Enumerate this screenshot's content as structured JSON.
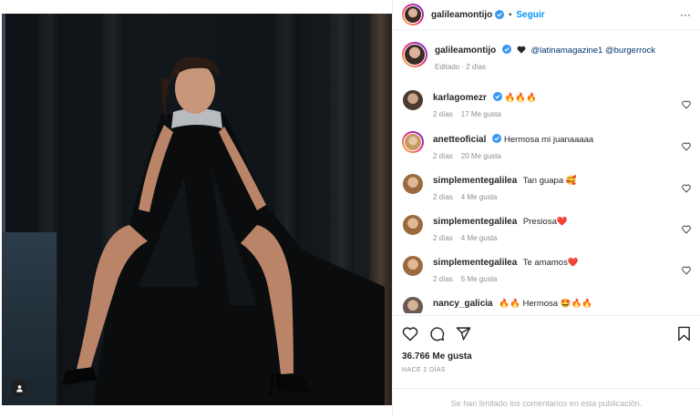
{
  "post": {
    "username": "galileamontijo",
    "follow_label": "Seguir",
    "dot": "•",
    "more_label": "···",
    "caption_mention_1": "@latinamagazine1",
    "caption_mention_2": "@burgerrock",
    "caption_meta": "Editado · 2 días",
    "likes": "36.766 Me gusta",
    "posted": "HACE 2 DÍAS",
    "comments_limited": "Se han limitado los comentarios en esta publicación."
  },
  "comments": [
    {
      "user": "karlagomezr",
      "verified": true,
      "text": "🔥🔥🔥",
      "age": "2 días",
      "likes": "17 Me gusta"
    },
    {
      "user": "anetteoficial",
      "verified": true,
      "text": "Hermosa mi juanaaaaa",
      "age": "2 días",
      "likes": "20 Me gusta"
    },
    {
      "user": "simplementegalilea",
      "verified": false,
      "text": "Tan guapa 🥰",
      "age": "2 días",
      "likes": "4 Me gusta"
    },
    {
      "user": "simplementegalilea",
      "verified": false,
      "text": "Presiosa❤️",
      "age": "2 días",
      "likes": "4 Me gusta"
    },
    {
      "user": "simplementegalilea",
      "verified": false,
      "text": "Te amamos❤️",
      "age": "2 días",
      "likes": "5 Me gusta"
    },
    {
      "user": "nancy_galicia",
      "verified": false,
      "text": "🔥🔥 Hermosa 🤩🔥🔥",
      "age": "",
      "likes": ""
    }
  ],
  "icons": [
    "heart-icon",
    "comment-icon",
    "share-icon",
    "save-icon",
    "verified-icon",
    "user-tag-icon",
    "more-icon"
  ],
  "colors": {
    "accent": "#0095f6",
    "verified": "#3897f0",
    "muted": "#8e8e8e"
  }
}
